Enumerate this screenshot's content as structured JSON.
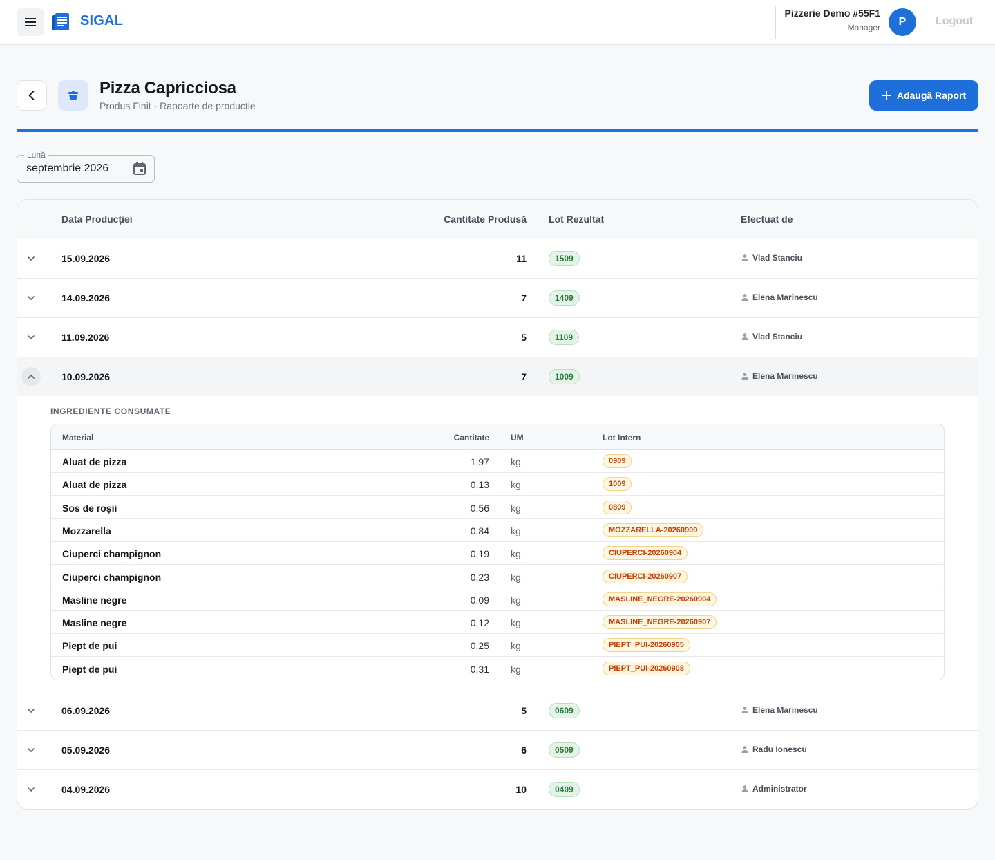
{
  "topbar": {
    "brand": "SIGAL",
    "org_name": "Pizzerie Demo #55F1",
    "org_role": "Manager",
    "avatar_initial": "P",
    "logout_label": "Logout"
  },
  "header": {
    "title": "Pizza Capricciosa",
    "subtitle": "Produs Finit · Rapoarte de producție",
    "add_button_label": "Adaugă Raport"
  },
  "filter": {
    "month_label": "Lună",
    "month_value": "septembrie 2026"
  },
  "table": {
    "columns": {
      "date": "Data Producției",
      "quantity": "Cantitate Produsă",
      "lot": "Lot Rezultat",
      "user": "Efectuat de"
    },
    "rows": [
      {
        "date": "15.09.2026",
        "quantity": "11",
        "lot": "1509",
        "user": "Vlad Stanciu",
        "expanded": false
      },
      {
        "date": "14.09.2026",
        "quantity": "7",
        "lot": "1409",
        "user": "Elena Marinescu",
        "expanded": false
      },
      {
        "date": "11.09.2026",
        "quantity": "5",
        "lot": "1109",
        "user": "Vlad Stanciu",
        "expanded": false
      },
      {
        "date": "10.09.2026",
        "quantity": "7",
        "lot": "1009",
        "user": "Elena Marinescu",
        "expanded": true
      },
      {
        "date": "06.09.2026",
        "quantity": "5",
        "lot": "0609",
        "user": "Elena Marinescu",
        "expanded": false
      },
      {
        "date": "05.09.2026",
        "quantity": "6",
        "lot": "0509",
        "user": "Radu Ionescu",
        "expanded": false
      },
      {
        "date": "04.09.2026",
        "quantity": "10",
        "lot": "0409",
        "user": "Administrator",
        "expanded": false
      }
    ]
  },
  "ingredients": {
    "title": "INGREDIENTE CONSUMATE",
    "columns": {
      "material": "Material",
      "quantity": "Cantitate",
      "um": "UM",
      "lot": "Lot Intern"
    },
    "rows": [
      {
        "material": "Aluat de pizza",
        "quantity": "1,97",
        "um": "kg",
        "lot": "0909"
      },
      {
        "material": "Aluat de pizza",
        "quantity": "0,13",
        "um": "kg",
        "lot": "1009"
      },
      {
        "material": "Sos de roșii",
        "quantity": "0,56",
        "um": "kg",
        "lot": "0809"
      },
      {
        "material": "Mozzarella",
        "quantity": "0,84",
        "um": "kg",
        "lot": "MOZZARELLA-20260909"
      },
      {
        "material": "Ciuperci champignon",
        "quantity": "0,19",
        "um": "kg",
        "lot": "CIUPERCI-20260904"
      },
      {
        "material": "Ciuperci champignon",
        "quantity": "0,23",
        "um": "kg",
        "lot": "CIUPERCI-20260907"
      },
      {
        "material": "Masline negre",
        "quantity": "0,09",
        "um": "kg",
        "lot": "MASLINE_NEGRE-20260904"
      },
      {
        "material": "Masline negre",
        "quantity": "0,12",
        "um": "kg",
        "lot": "MASLINE_NEGRE-20260907"
      },
      {
        "material": "Piept de pui",
        "quantity": "0,25",
        "um": "kg",
        "lot": "PIEPT_PUI-20260905"
      },
      {
        "material": "Piept de pui",
        "quantity": "0,31",
        "um": "kg",
        "lot": "PIEPT_PUI-20260908"
      }
    ]
  },
  "colors": {
    "accent": "#1e6fd9",
    "lot_result_bg": "#e3f4e6",
    "lot_result_text": "#2a7a3b",
    "lot_internal_bg": "#fff6e0",
    "lot_internal_text": "#c2410c"
  },
  "icons": {
    "menu": "menu-icon",
    "logo": "document-stack-icon",
    "back": "chevron-left-icon",
    "product": "bowl-icon",
    "add": "plus-icon",
    "calendar": "calendar-icon",
    "expand": "chevron-down-icon",
    "collapse": "chevron-up-icon",
    "user": "person-icon"
  }
}
